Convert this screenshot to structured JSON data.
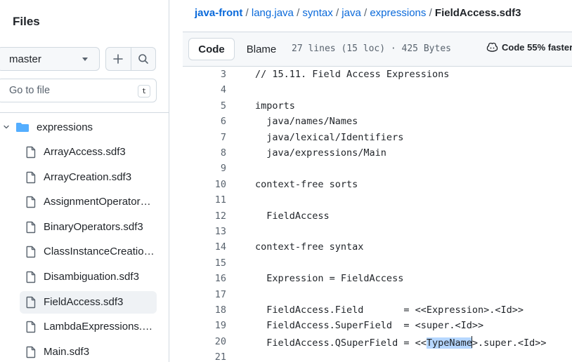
{
  "sidebar": {
    "title": "Files",
    "branch": "master",
    "goto_placeholder": "Go to file",
    "goto_shortcut": "t",
    "folder": "expressions",
    "files": [
      {
        "name": "ArrayAccess.sdf3",
        "active": false
      },
      {
        "name": "ArrayCreation.sdf3",
        "active": false
      },
      {
        "name": "AssignmentOperator…",
        "active": false
      },
      {
        "name": "BinaryOperators.sdf3",
        "active": false
      },
      {
        "name": "ClassInstanceCreatio…",
        "active": false
      },
      {
        "name": "Disambiguation.sdf3",
        "active": false
      },
      {
        "name": "FieldAccess.sdf3",
        "active": true
      },
      {
        "name": "LambdaExpressions.…",
        "active": false
      },
      {
        "name": "Main.sdf3",
        "active": false
      }
    ]
  },
  "breadcrumb": {
    "repo": "java-front",
    "parts": [
      "lang.java",
      "syntax",
      "java",
      "expressions"
    ],
    "separator": "/",
    "current": "FieldAccess.sdf3"
  },
  "toolbar": {
    "code_label": "Code",
    "blame_label": "Blame",
    "meta": "27 lines (15 loc) · 425 Bytes",
    "copilot_label": "Code 55% faster"
  },
  "code": {
    "lines": [
      {
        "n": "3",
        "text": "// 15.11. Field Access Expressions"
      },
      {
        "n": "4",
        "text": ""
      },
      {
        "n": "5",
        "text": "imports"
      },
      {
        "n": "6",
        "text": "  java/names/Names"
      },
      {
        "n": "7",
        "text": "  java/lexical/Identifiers"
      },
      {
        "n": "8",
        "text": "  java/expressions/Main"
      },
      {
        "n": "9",
        "text": ""
      },
      {
        "n": "10",
        "text": "context-free sorts"
      },
      {
        "n": "11",
        "text": ""
      },
      {
        "n": "12",
        "text": "  FieldAccess"
      },
      {
        "n": "13",
        "text": ""
      },
      {
        "n": "14",
        "text": "context-free syntax"
      },
      {
        "n": "15",
        "text": ""
      },
      {
        "n": "16",
        "text": "  Expression = FieldAccess"
      },
      {
        "n": "17",
        "text": ""
      },
      {
        "n": "18",
        "text": "  FieldAccess.Field       = <<Expression>.<Id>>"
      },
      {
        "n": "19",
        "text": "  FieldAccess.SuperField  = <super.<Id>>"
      },
      {
        "n": "20",
        "text": "  FieldAccess.QSuperField = <<TypeName>.super.<Id>>",
        "hl_before": "  FieldAccess.QSuperField = <<",
        "hl": "TypeName",
        "hl_after": ">.super.<Id>>"
      },
      {
        "n": "21",
        "text": ""
      }
    ]
  },
  "colors": {
    "accent": "#0969da",
    "folder": "#54aeff",
    "selection": "#b6d7ff"
  }
}
